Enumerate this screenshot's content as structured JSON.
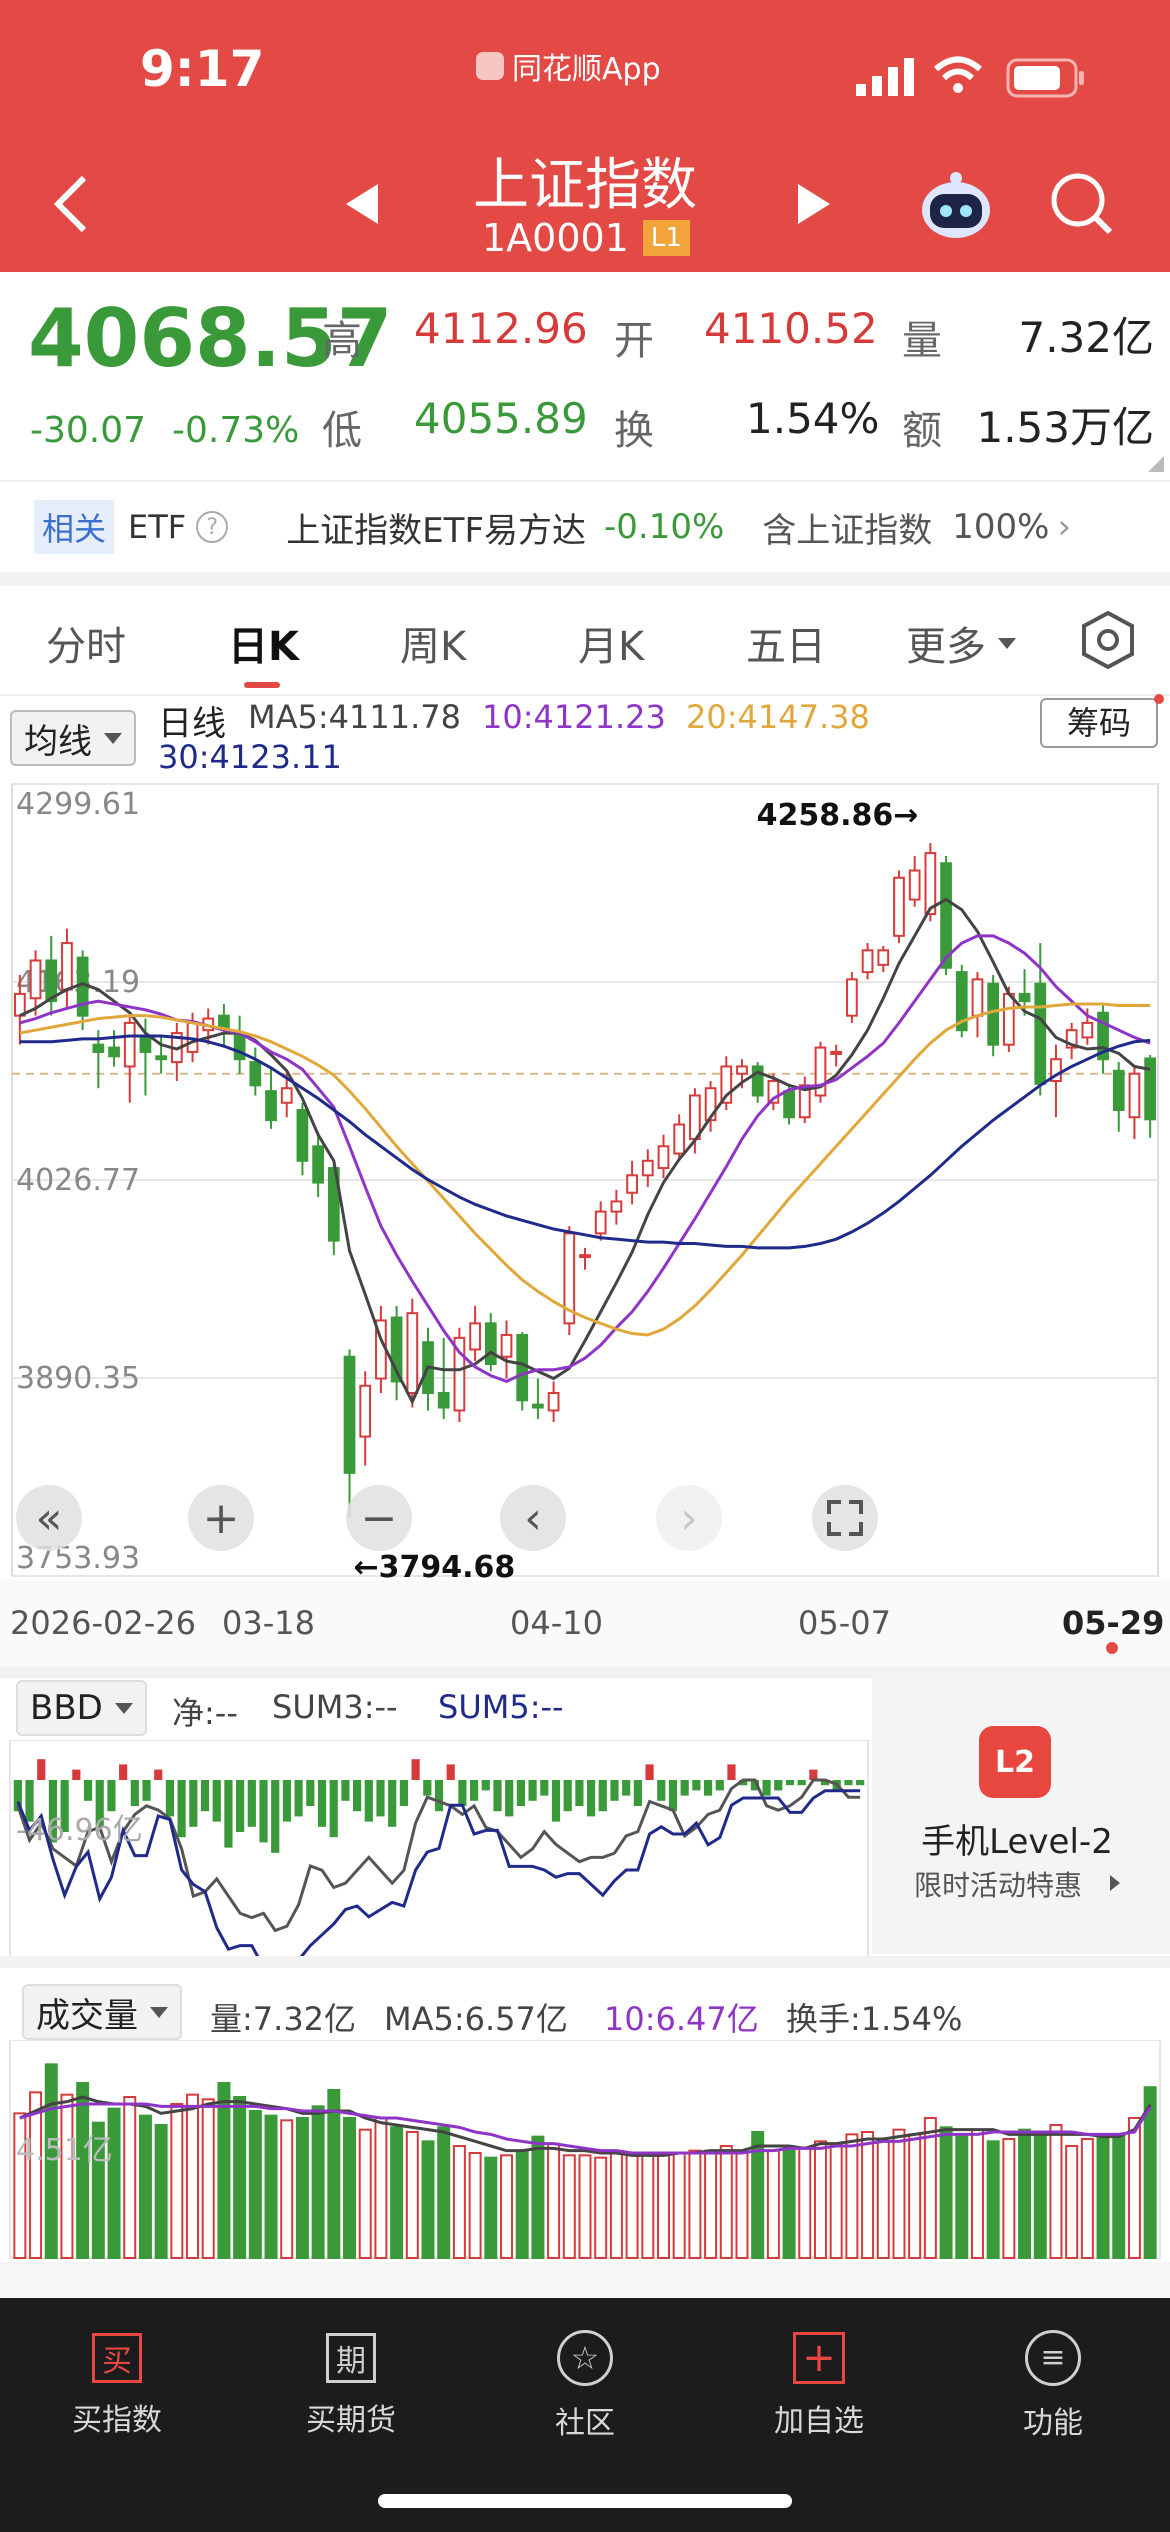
{
  "status_bar": {
    "time": "9:17",
    "app": "同花顺App"
  },
  "header": {
    "title": "上证指数",
    "code": "1A0001",
    "level": "L1"
  },
  "quote": {
    "price": "4068.57",
    "change": "-30.07",
    "change_pct": "-0.73%",
    "high_label": "高",
    "high": "4112.96",
    "open_label": "开",
    "open": "4110.52",
    "vol_label": "量",
    "vol": "7.32亿",
    "low_label": "低",
    "low": "4055.89",
    "turnover_label": "换",
    "turnover": "1.54%",
    "amount_label": "额",
    "amount": "1.53万亿",
    "colors": {
      "up": "#d63b3b",
      "down": "#3a9a3a"
    }
  },
  "related": {
    "tag": "相关",
    "etf": "ETF",
    "help": "?",
    "fund_name": "上证指数ETF易方达",
    "fund_change": "-0.10%",
    "contains": "含上证指数",
    "contains_pct": "100%"
  },
  "tabs": [
    {
      "label": "分时"
    },
    {
      "label": "日K"
    },
    {
      "label": "周K"
    },
    {
      "label": "月K"
    },
    {
      "label": "五日"
    },
    {
      "label": "更多"
    }
  ],
  "active_tab": "日K",
  "kline": {
    "ma_selector": "均线",
    "period": "日线",
    "ma5": "MA5:4111.78",
    "ma10": "10:4121.23",
    "ma20": "20:4147.38",
    "ma30": "30:4123.11",
    "chip_button": "筹码",
    "y_ticks": [
      "4299.61",
      "4163.19",
      "4026.77",
      "3890.35",
      "3753.93"
    ],
    "x_ticks": [
      "2026-02-26",
      "03-18",
      "04-10",
      "05-07",
      "05-29"
    ],
    "max_label": "4258.86→",
    "min_label": "←3794.68"
  },
  "bbd": {
    "selector": "BBD",
    "net": "净:--",
    "sum3": "SUM3:--",
    "sum5": "SUM5:--",
    "ylabel": "-46.96亿"
  },
  "level2": {
    "title": "手机Level-2",
    "subtitle": "限时活动特惠",
    "logo": "L2"
  },
  "volume": {
    "selector": "成交量",
    "vol": "量:7.32亿",
    "ma5": "MA5:6.57亿",
    "ma10": "10:6.47亿",
    "turnover": "换手:1.54%",
    "ylabel": "4.51亿"
  },
  "bottom_nav": [
    {
      "label": "买指数",
      "glyph": "买"
    },
    {
      "label": "买期货",
      "glyph": "期"
    },
    {
      "label": "社区",
      "glyph": "☆"
    },
    {
      "label": "加自选",
      "glyph": "+"
    },
    {
      "label": "功能",
      "glyph": "≡"
    }
  ],
  "chart_data": [
    {
      "type": "candlestick",
      "title": "上证指数 日K",
      "x_ticks": [
        "2026-02-26",
        "03-18",
        "04-10",
        "05-07",
        "05-29"
      ],
      "ylim": [
        3753.93,
        4299.61
      ],
      "y_ticks": [
        4299.61,
        4163.19,
        4026.77,
        3890.35,
        3753.93
      ],
      "grid": true,
      "candles": [
        [
          4140,
          4155,
          4168,
          4120
        ],
        [
          4152,
          4178,
          4185,
          4140
        ],
        [
          4178,
          4150,
          4195,
          4140
        ],
        [
          4158,
          4190,
          4200,
          4145
        ],
        [
          4180,
          4140,
          4185,
          4130
        ],
        [
          4120,
          4115,
          4130,
          4090
        ],
        [
          4118,
          4112,
          4130,
          4105
        ],
        [
          4105,
          4135,
          4140,
          4080
        ],
        [
          4125,
          4115,
          4138,
          4085
        ],
        [
          4112,
          4110,
          4125,
          4100
        ],
        [
          4108,
          4128,
          4135,
          4095
        ],
        [
          4115,
          4135,
          4142,
          4108
        ],
        [
          4130,
          4138,
          4145,
          4120
        ],
        [
          4140,
          4132,
          4148,
          4118
        ],
        [
          4128,
          4110,
          4140,
          4100
        ],
        [
          4108,
          4092,
          4118,
          4085
        ],
        [
          4088,
          4068,
          4105,
          4062
        ],
        [
          4080,
          4090,
          4100,
          4070
        ],
        [
          4075,
          4040,
          4080,
          4030
        ],
        [
          4050,
          4025,
          4060,
          4015
        ],
        [
          4035,
          3985,
          4040,
          3975
        ],
        [
          3905,
          3825,
          3910,
          3794.68
        ],
        [
          3850,
          3885,
          3895,
          3830
        ],
        [
          3890,
          3930,
          3940,
          3880
        ],
        [
          3932,
          3888,
          3940,
          3875
        ],
        [
          3880,
          3935,
          3945,
          3870
        ],
        [
          3915,
          3880,
          3925,
          3868
        ],
        [
          3880,
          3870,
          3918,
          3862
        ],
        [
          3868,
          3918,
          3925,
          3860
        ],
        [
          3910,
          3928,
          3940,
          3902
        ],
        [
          3928,
          3900,
          3935,
          3895
        ],
        [
          3905,
          3920,
          3930,
          3890
        ],
        [
          3920,
          3875,
          3922,
          3868
        ],
        [
          3872,
          3870,
          3890,
          3862
        ],
        [
          3868,
          3880,
          3888,
          3860
        ],
        [
          3928,
          3990,
          3995,
          3920
        ],
        [
          3975,
          3975,
          3980,
          3965
        ],
        [
          3990,
          4005,
          4012,
          3985
        ],
        [
          4005,
          4012,
          4020,
          3996
        ],
        [
          4018,
          4030,
          4040,
          4010
        ],
        [
          4030,
          4040,
          4048,
          4022
        ],
        [
          4035,
          4050,
          4058,
          4028
        ],
        [
          4045,
          4065,
          4072,
          4040
        ],
        [
          4055,
          4085,
          4090,
          4045
        ],
        [
          4068,
          4090,
          4095,
          4060
        ],
        [
          4080,
          4105,
          4112,
          4075
        ],
        [
          4100,
          4105,
          4110,
          4090
        ],
        [
          4105,
          4085,
          4108,
          4080
        ],
        [
          4080,
          4095,
          4100,
          4075
        ],
        [
          4088,
          4070,
          4092,
          4065
        ],
        [
          4070,
          4092,
          4098,
          4066
        ],
        [
          4085,
          4118,
          4122,
          4080
        ],
        [
          4115,
          4115,
          4120,
          4105
        ],
        [
          4140,
          4165,
          4170,
          4135
        ],
        [
          4170,
          4185,
          4190,
          4165
        ],
        [
          4175,
          4185,
          4188,
          4170
        ],
        [
          4195,
          4235,
          4240,
          4190
        ],
        [
          4220,
          4240,
          4250,
          4215
        ],
        [
          4210,
          4252,
          4258.86,
          4205
        ],
        [
          4245,
          4173,
          4250,
          4168
        ],
        [
          4170,
          4130,
          4175,
          4125
        ],
        [
          4140,
          4165,
          4170,
          4125
        ],
        [
          4162,
          4120,
          4168,
          4112
        ],
        [
          4120,
          4155,
          4160,
          4115
        ],
        [
          4155,
          4150,
          4172,
          4140
        ],
        [
          4162,
          4093,
          4190,
          4085
        ],
        [
          4095,
          4110,
          4120,
          4070
        ],
        [
          4118,
          4130,
          4135,
          4110
        ],
        [
          4125,
          4135,
          4145,
          4120
        ],
        [
          4142,
          4110,
          4148,
          4100
        ],
        [
          4102,
          4075,
          4108,
          4060
        ],
        [
          4070,
          4100,
          4105,
          4055
        ],
        [
          4110.52,
          4068.57,
          4112.96,
          4055.89
        ]
      ],
      "candle_fields": [
        "open",
        "close",
        "high",
        "low"
      ],
      "series": [
        {
          "name": "MA5",
          "values": [
            4140,
            4145,
            4152,
            4158,
            4162,
            4158,
            4150,
            4142,
            4128,
            4120,
            4117,
            4122,
            4125,
            4128,
            4128,
            4123,
            4113,
            4102,
            4083,
            4058,
            4040,
            3978,
            3948,
            3917,
            3895,
            3874,
            3898,
            3896,
            3896,
            3900,
            3908,
            3902,
            3900,
            3895,
            3890,
            3897,
            3916,
            3936,
            3956,
            3977,
            4003,
            4025,
            4041,
            4054,
            4070,
            4085,
            4094,
            4101,
            4097,
            4092,
            4089,
            4091,
            4099,
            4113,
            4130,
            4152,
            4176,
            4195,
            4214,
            4220,
            4213,
            4198,
            4177,
            4155,
            4143,
            4138,
            4125,
            4120,
            4117,
            4118,
            4114,
            4105,
            4103
          ]
        },
        {
          "name": "10",
          "values": [
            4135,
            4138,
            4142,
            4145,
            4148,
            4150,
            4148,
            4146,
            4144,
            4141,
            4137,
            4136,
            4133,
            4130,
            4128,
            4122,
            4115,
            4110,
            4103,
            4090,
            4077,
            4050,
            4022,
            3995,
            3975,
            3957,
            3940,
            3923,
            3908,
            3898,
            3892,
            3888,
            3893,
            3896,
            3896,
            3898,
            3904,
            3913,
            3925,
            3936,
            3950,
            3966,
            3983,
            4000,
            4018,
            4036,
            4055,
            4071,
            4083,
            4089,
            4091,
            4092,
            4096,
            4104,
            4112,
            4121,
            4135,
            4150,
            4165,
            4180,
            4190,
            4195,
            4195,
            4190,
            4183,
            4173,
            4160,
            4150,
            4140,
            4135,
            4130,
            4125,
            4121
          ]
        },
        {
          "name": "20",
          "values": [
            4128,
            4130,
            4132,
            4134,
            4136,
            4138,
            4139,
            4140,
            4140,
            4139,
            4137,
            4135,
            4133,
            4131,
            4129,
            4126,
            4122,
            4117,
            4112,
            4106,
            4099,
            4088,
            4076,
            4063,
            4050,
            4038,
            4026,
            4014,
            4002,
            3990,
            3979,
            3968,
            3958,
            3950,
            3943,
            3937,
            3932,
            3928,
            3924,
            3921,
            3920,
            3924,
            3931,
            3940,
            3951,
            3963,
            3975,
            3988,
            4001,
            4014,
            4026,
            4038,
            4050,
            4062,
            4074,
            4086,
            4098,
            4110,
            4121,
            4130,
            4136,
            4140,
            4143,
            4145,
            4146,
            4146,
            4147,
            4148,
            4148,
            4148,
            4147,
            4147,
            4147
          ]
        },
        {
          "name": "30",
          "values": [
            4122,
            4122,
            4122,
            4123,
            4124,
            4124,
            4125,
            4126,
            4126,
            4126,
            4125,
            4124,
            4122,
            4119,
            4115,
            4110,
            4104,
            4097,
            4090,
            4083,
            4075,
            4067,
            4058,
            4050,
            4042,
            4034,
            4027,
            4021,
            4015,
            4010,
            4006,
            4002,
            3999,
            3996,
            3993,
            3991,
            3989,
            3987,
            3986,
            3985,
            3984,
            3984,
            3983,
            3983,
            3982,
            3981,
            3981,
            3980,
            3980,
            3980,
            3981,
            3983,
            3986,
            3991,
            3997,
            4004,
            4012,
            4021,
            4030,
            4040,
            4050,
            4059,
            4068,
            4076,
            4084,
            4092,
            4099,
            4105,
            4110,
            4115,
            4119,
            4122,
            4123
          ]
        }
      ]
    },
    {
      "type": "bar",
      "title": "BBD",
      "values": [
        -6,
        -8,
        4,
        -12,
        -10,
        2,
        -4,
        -9,
        -6,
        3,
        -5,
        -4,
        2,
        -7,
        -11,
        -9,
        -6,
        -8,
        -13,
        -10,
        -9,
        -12,
        -14,
        -8,
        -7,
        -5,
        -9,
        -11,
        -4,
        -6,
        -8,
        -7,
        -9,
        -5,
        4,
        -3,
        -6,
        3,
        -5,
        -4,
        -2,
        -6,
        -7,
        -5,
        -4,
        -3,
        -8,
        -6,
        -5,
        -7,
        -6,
        -4,
        -3,
        -5,
        3,
        -4,
        -6,
        -3,
        -2,
        -3,
        -2,
        3,
        -1,
        -2,
        -3,
        -2,
        -1,
        -1,
        2,
        -1,
        -2,
        -1,
        -1
      ],
      "ylabel": "-46.96亿"
    },
    {
      "type": "bar",
      "title": "成交量",
      "values": [
        6.2,
        7.1,
        8.3,
        7.0,
        7.5,
        5.8,
        6.4,
        6.9,
        6.1,
        5.7,
        6.6,
        7.0,
        6.8,
        7.5,
        6.9,
        6.3,
        6.1,
        5.9,
        6.0,
        6.5,
        7.2,
        6.0,
        5.5,
        6.0,
        5.6,
        5.4,
        5.0,
        5.6,
        4.8,
        4.5,
        4.3,
        4.4,
        4.6,
        5.2,
        4.9,
        4.4,
        4.4,
        4.3,
        4.5,
        4.4,
        4.5,
        4.4,
        4.5,
        4.6,
        4.6,
        4.8,
        4.5,
        5.4,
        4.6,
        4.6,
        4.7,
        5.0,
        4.8,
        5.3,
        5.4,
        5.0,
        5.5,
        5.3,
        6.0,
        5.6,
        5.2,
        5.5,
        5.0,
        5.1,
        5.5,
        5.3,
        5.7,
        4.8,
        5.1,
        5.2,
        5.3,
        6.0,
        7.32
      ],
      "series": [
        {
          "name": "MA5",
          "values": [
            6.0,
            6.3,
            6.6,
            6.7,
            6.9,
            6.7,
            6.6,
            6.6,
            6.5,
            6.2,
            6.3,
            6.4,
            6.6,
            6.7,
            6.7,
            6.6,
            6.5,
            6.4,
            6.2,
            6.2,
            6.3,
            6.3,
            6.0,
            5.8,
            5.7,
            5.6,
            5.5,
            5.4,
            5.2,
            5.0,
            4.8,
            4.6,
            4.6,
            4.7,
            4.7,
            4.6,
            4.6,
            4.5,
            4.5,
            4.4,
            4.4,
            4.4,
            4.5,
            4.5,
            4.6,
            4.6,
            4.6,
            4.8,
            4.8,
            4.8,
            4.7,
            4.9,
            4.9,
            5.0,
            5.1,
            5.1,
            5.2,
            5.3,
            5.4,
            5.5,
            5.5,
            5.5,
            5.5,
            5.3,
            5.3,
            5.3,
            5.3,
            5.3,
            5.3,
            5.2,
            5.2,
            5.5,
            6.57
          ]
        },
        {
          "name": "10",
          "values": [
            6.0,
            6.2,
            6.4,
            6.5,
            6.6,
            6.6,
            6.6,
            6.6,
            6.6,
            6.5,
            6.5,
            6.5,
            6.5,
            6.5,
            6.5,
            6.5,
            6.4,
            6.4,
            6.3,
            6.3,
            6.3,
            6.2,
            6.1,
            6.0,
            6.0,
            5.9,
            5.8,
            5.7,
            5.6,
            5.4,
            5.3,
            5.1,
            5.0,
            4.9,
            4.9,
            4.8,
            4.7,
            4.6,
            4.6,
            4.5,
            4.5,
            4.5,
            4.5,
            4.5,
            4.5,
            4.5,
            4.5,
            4.6,
            4.6,
            4.7,
            4.7,
            4.7,
            4.8,
            4.8,
            4.9,
            5.0,
            5.0,
            5.1,
            5.2,
            5.3,
            5.3,
            5.3,
            5.4,
            5.4,
            5.4,
            5.4,
            5.4,
            5.4,
            5.3,
            5.3,
            5.3,
            5.4,
            6.47
          ]
        }
      ],
      "ylabel": "4.51亿"
    }
  ]
}
